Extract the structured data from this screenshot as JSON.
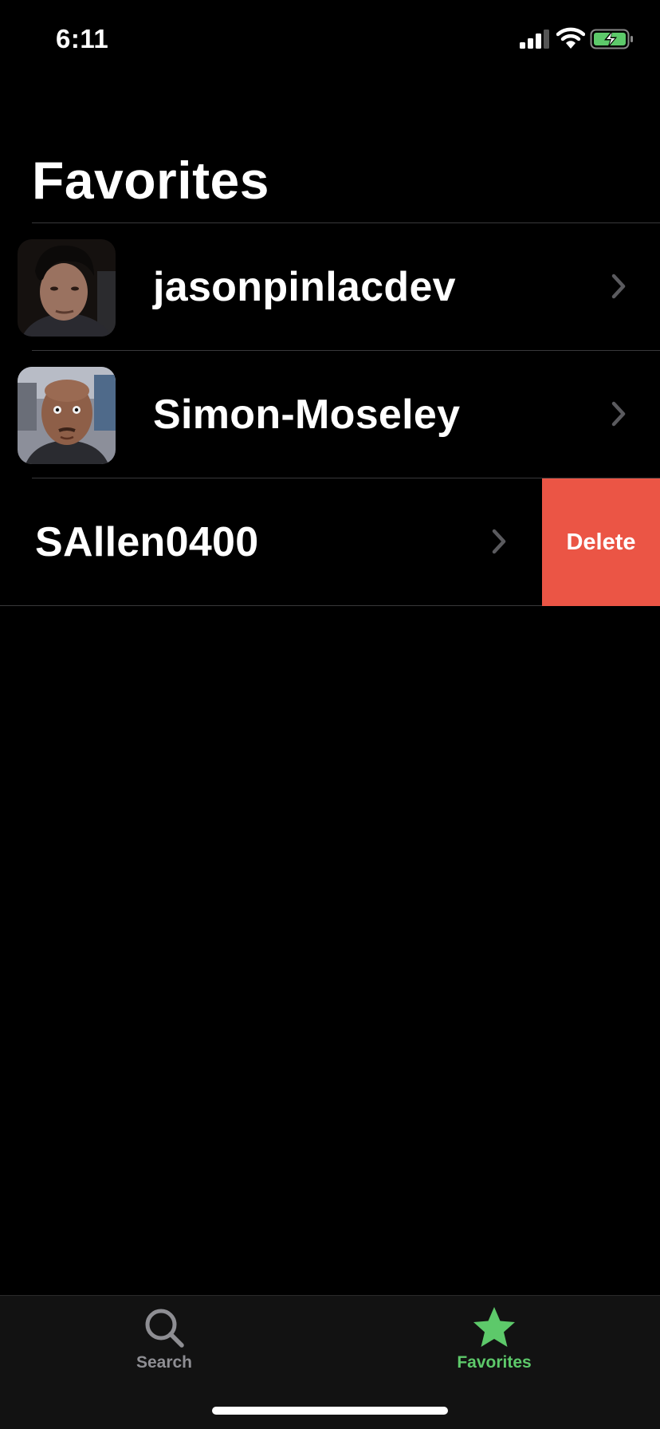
{
  "status_bar": {
    "time": "6:11"
  },
  "page": {
    "title": "Favorites"
  },
  "favorites": [
    {
      "name": "jasonpinlacdev",
      "has_avatar": true
    },
    {
      "name": "Simon-Moseley",
      "has_avatar": true
    },
    {
      "name": "SAllen0400",
      "has_avatar": false,
      "swiped": true
    }
  ],
  "row_actions": {
    "delete_label": "Delete"
  },
  "tab_bar": {
    "tabs": [
      {
        "label": "Search",
        "icon": "magnifying-glass-icon",
        "active": false
      },
      {
        "label": "Favorites",
        "icon": "star-icon",
        "active": true
      }
    ]
  },
  "colors": {
    "background": "#000000",
    "accent": "#5dc96a",
    "delete": "#eb5545",
    "inactive": "#8e8e93",
    "battery": "#5dc96a"
  }
}
